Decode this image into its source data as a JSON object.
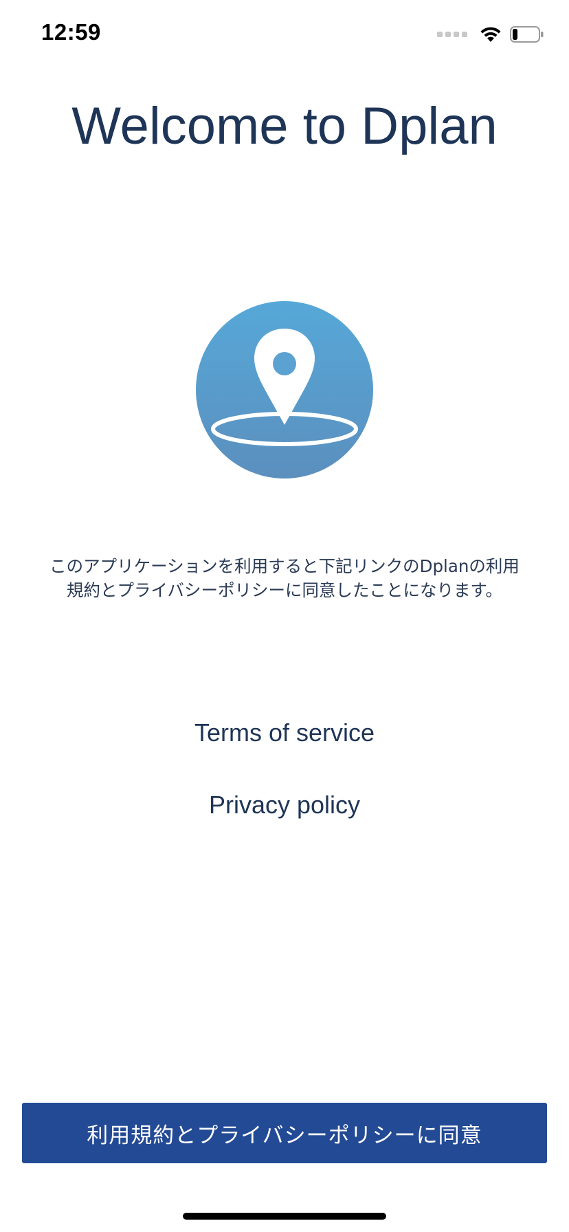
{
  "status_bar": {
    "time": "12:59",
    "icons": [
      "signal-dots-icon",
      "wifi-icon",
      "battery-icon"
    ],
    "battery_level": 0.2
  },
  "welcome": {
    "title": "Welcome to Dplan"
  },
  "logo": {
    "icon": "location-pin-icon",
    "colors": {
      "gradient_top": "#56a8d8",
      "gradient_bottom": "#5b8fbe",
      "glyph": "#ffffff"
    }
  },
  "consent": {
    "text": "このアプリケーションを利用すると下記リンクのDplanの利用規約とプライバシーポリシーに同意したことになります。"
  },
  "links": {
    "terms": "Terms of service",
    "privacy": "Privacy policy"
  },
  "agree_button": {
    "label": "利用規約とプライバシーポリシーに同意",
    "color": "#234a95"
  },
  "colors": {
    "text_primary": "#1f3557",
    "background": "#ffffff"
  }
}
